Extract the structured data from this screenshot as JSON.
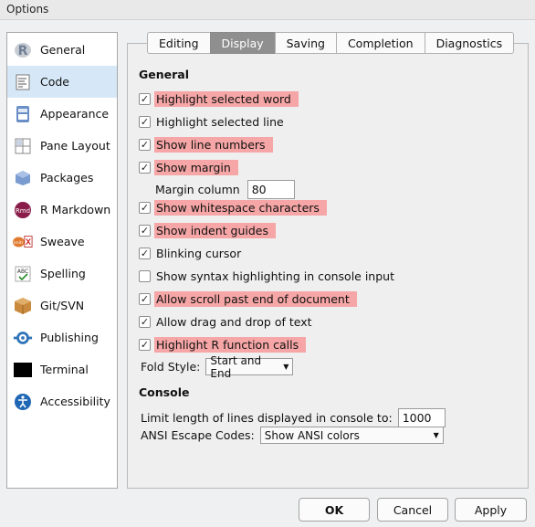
{
  "window": {
    "title": "Options"
  },
  "sidebar": {
    "items": [
      {
        "label": "General",
        "icon": "r-logo-icon"
      },
      {
        "label": "Code",
        "icon": "code-document-icon",
        "selected": true
      },
      {
        "label": "Appearance",
        "icon": "appearance-icon"
      },
      {
        "label": "Pane Layout",
        "icon": "pane-layout-icon"
      },
      {
        "label": "Packages",
        "icon": "package-box-icon"
      },
      {
        "label": "R Markdown",
        "icon": "rmd-icon"
      },
      {
        "label": "Sweave",
        "icon": "sweave-icon"
      },
      {
        "label": "Spelling",
        "icon": "spelling-abc-icon"
      },
      {
        "label": "Git/SVN",
        "icon": "git-box-icon"
      },
      {
        "label": "Publishing",
        "icon": "publishing-icon"
      },
      {
        "label": "Terminal",
        "icon": "terminal-icon"
      },
      {
        "label": "Accessibility",
        "icon": "accessibility-icon"
      }
    ]
  },
  "tabs": [
    {
      "label": "Editing"
    },
    {
      "label": "Display",
      "active": true
    },
    {
      "label": "Saving"
    },
    {
      "label": "Completion"
    },
    {
      "label": "Diagnostics"
    }
  ],
  "general": {
    "title": "General",
    "options": [
      {
        "label": "Highlight selected word",
        "checked": true,
        "highlighted": true
      },
      {
        "label": "Highlight selected line",
        "checked": true,
        "highlighted": false
      },
      {
        "label": "Show line numbers",
        "checked": true,
        "highlighted": true
      },
      {
        "label": "Show margin",
        "checked": true,
        "highlighted": true
      },
      {
        "label": "Show whitespace characters",
        "checked": true,
        "highlighted": true
      },
      {
        "label": "Show indent guides",
        "checked": true,
        "highlighted": true
      },
      {
        "label": "Blinking cursor",
        "checked": true,
        "highlighted": false
      },
      {
        "label": "Show syntax highlighting in console input",
        "checked": false,
        "highlighted": false
      },
      {
        "label": "Allow scroll past end of document",
        "checked": true,
        "highlighted": true
      },
      {
        "label": "Allow drag and drop of text",
        "checked": true,
        "highlighted": false
      },
      {
        "label": "Highlight R function calls",
        "checked": true,
        "highlighted": true
      }
    ],
    "margin_column_label": "Margin column",
    "margin_column_value": "80",
    "fold_style_label": "Fold Style:",
    "fold_style_value": "Start and End"
  },
  "console": {
    "title": "Console",
    "limit_label": "Limit length of lines displayed in console to:",
    "limit_value": "1000",
    "ansi_label": "ANSI Escape Codes:",
    "ansi_value": "Show ANSI colors"
  },
  "buttons": {
    "ok": "OK",
    "cancel": "Cancel",
    "apply": "Apply"
  },
  "colors": {
    "highlight": "#f6a6a6",
    "selected_sidebar": "#d6e8f7",
    "active_tab": "#8f8f8f"
  }
}
